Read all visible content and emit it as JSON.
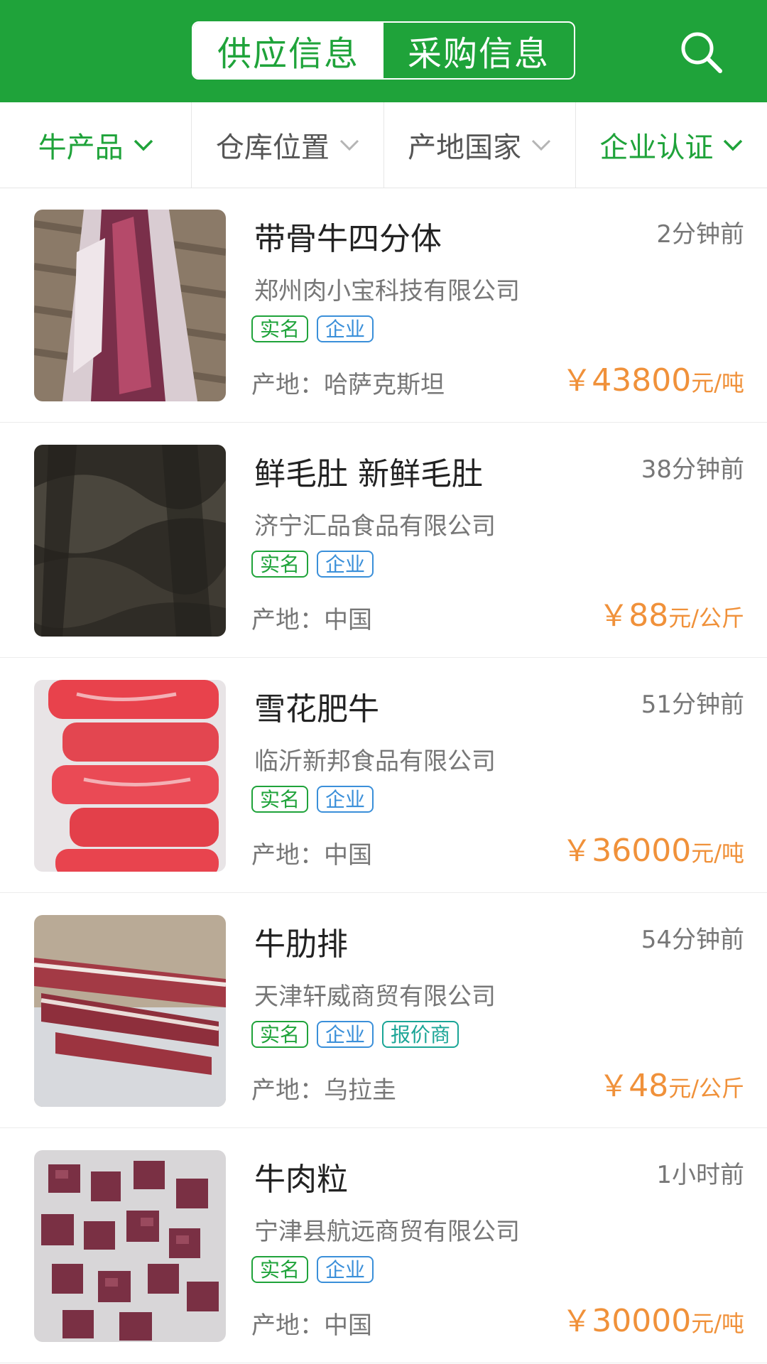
{
  "header": {
    "tabs": [
      {
        "label": "供应信息",
        "active": true
      },
      {
        "label": "采购信息",
        "active": false
      }
    ],
    "search_icon": "search-icon",
    "brand_color": "#1fa33a"
  },
  "filters": [
    {
      "label": "牛产品",
      "active": true
    },
    {
      "label": "仓库位置",
      "active": false
    },
    {
      "label": "产地国家",
      "active": false
    },
    {
      "label": "企业认证",
      "active": true
    }
  ],
  "items": [
    {
      "title": "带骨牛四分体",
      "time": "2分钟前",
      "company": "郑州肉小宝科技有限公司",
      "badges": [
        "实名",
        "企业"
      ],
      "origin": "产地：哈萨克斯坦",
      "price_currency": "￥",
      "price_value": "43800",
      "price_unit": "元/吨",
      "image": "beef-quarter-photo"
    },
    {
      "title": "鲜毛肚 新鲜毛肚",
      "time": "38分钟前",
      "company": "济宁汇品食品有限公司",
      "badges": [
        "实名",
        "企业"
      ],
      "origin": "产地：中国",
      "price_currency": "￥",
      "price_value": "88",
      "price_unit": "元/公斤",
      "image": "tripe-photo"
    },
    {
      "title": "雪花肥牛",
      "time": "51分钟前",
      "company": "临沂新邦食品有限公司",
      "badges": [
        "实名",
        "企业"
      ],
      "origin": "产地：中国",
      "price_currency": "￥",
      "price_value": "36000",
      "price_unit": "元/吨",
      "image": "beef-roll-photo"
    },
    {
      "title": "牛肋排",
      "time": "54分钟前",
      "company": "天津轩威商贸有限公司",
      "badges": [
        "实名",
        "企业",
        "报价商"
      ],
      "origin": "产地：乌拉圭",
      "price_currency": "￥",
      "price_value": "48",
      "price_unit": "元/公斤",
      "image": "short-ribs-photo"
    },
    {
      "title": "牛肉粒",
      "time": "1小时前",
      "company": "宁津县航远商贸有限公司",
      "badges": [
        "实名",
        "企业"
      ],
      "origin": "产地：中国",
      "price_currency": "￥",
      "price_value": "30000",
      "price_unit": "元/吨",
      "image": "beef-cubes-photo"
    }
  ],
  "colors": {
    "price": "#f0913a",
    "badge_realname": "#1fa33a",
    "badge_company": "#3a8fd9",
    "badge_quoter": "#1aa596"
  }
}
